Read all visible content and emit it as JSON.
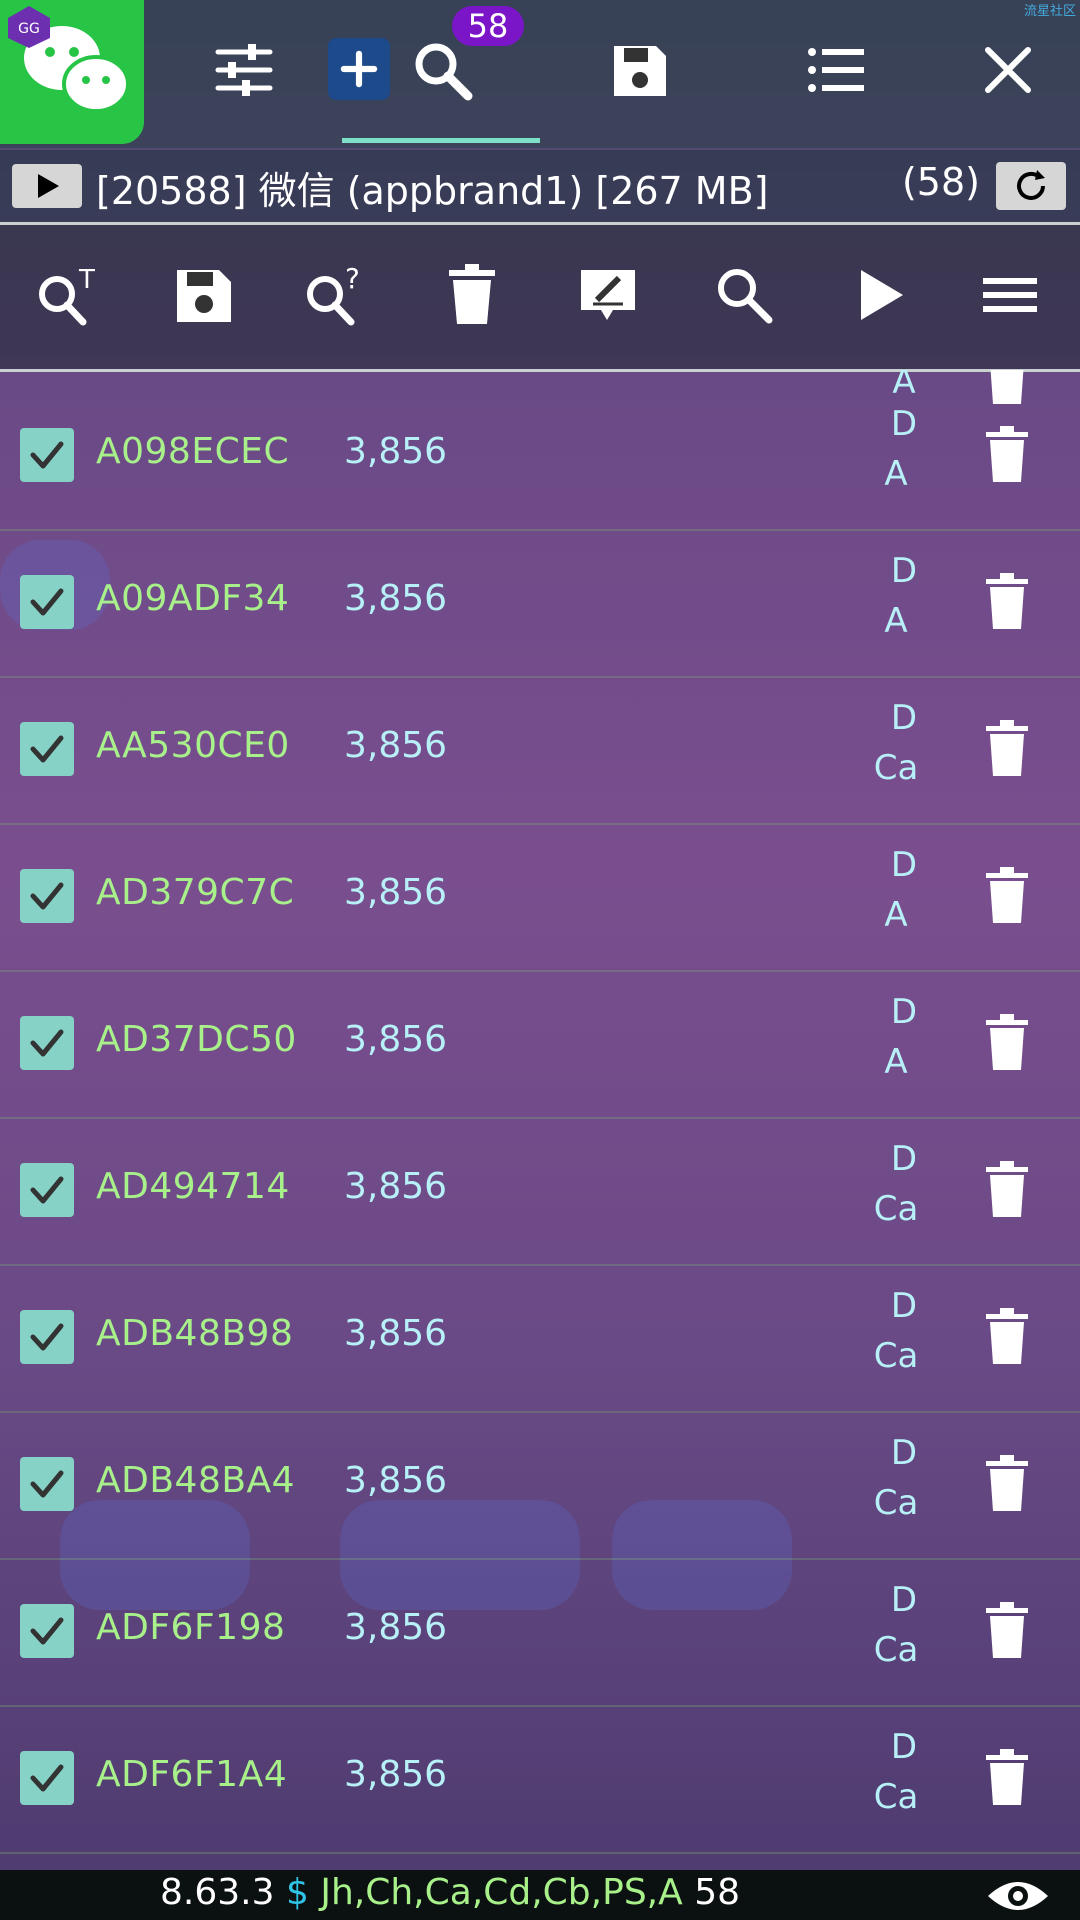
{
  "top_bar": {
    "badge_count": "58",
    "corner_text": "流星社区"
  },
  "process": {
    "text": "[20588] 微信 (appbrand1) [267 MB]",
    "count": "(58)"
  },
  "rows": [
    {
      "address": "A098ECEC",
      "value": "3,856",
      "flag1": "D",
      "flag2": "A"
    },
    {
      "address": "A09ADF34",
      "value": "3,856",
      "flag1": "D",
      "flag2": "A"
    },
    {
      "address": "AA530CE0",
      "value": "3,856",
      "flag1": "D",
      "flag2": "Ca"
    },
    {
      "address": "AD379C7C",
      "value": "3,856",
      "flag1": "D",
      "flag2": "A"
    },
    {
      "address": "AD37DC50",
      "value": "3,856",
      "flag1": "D",
      "flag2": "A"
    },
    {
      "address": "AD494714",
      "value": "3,856",
      "flag1": "D",
      "flag2": "Ca"
    },
    {
      "address": "ADB48B98",
      "value": "3,856",
      "flag1": "D",
      "flag2": "Ca"
    },
    {
      "address": "ADB48BA4",
      "value": "3,856",
      "flag1": "D",
      "flag2": "Ca"
    },
    {
      "address": "ADF6F198",
      "value": "3,856",
      "flag1": "D",
      "flag2": "Ca"
    },
    {
      "address": "ADF6F1A4",
      "value": "3,856",
      "flag1": "D",
      "flag2": "Ca"
    }
  ],
  "partial_row_flag": "A",
  "status_bar": {
    "version": "8.63.3",
    "dollar": "$",
    "types": "Jh,Ch,Ca,Cd,Cb,PS,A",
    "count": "58"
  },
  "icons": {
    "top": [
      "wechat-app-icon",
      "settings-sliders-icon",
      "add-icon",
      "search-icon",
      "save-icon",
      "list-icon",
      "close-icon"
    ],
    "tools": [
      "search-text-icon",
      "save-icon",
      "fuzzy-search-icon",
      "delete-icon",
      "edit-icon",
      "search-icon",
      "play-icon",
      "menu-icon"
    ],
    "status": [
      "eye-icon"
    ]
  },
  "colors": {
    "address": "#a8f08a",
    "value": "#b8f0f8",
    "checkbox": "#86d2c6",
    "badge": "#7a16c8",
    "tab_underline": "#7ee0c8"
  }
}
